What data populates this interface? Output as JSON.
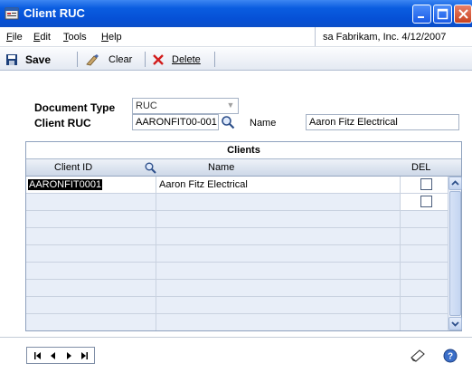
{
  "window": {
    "title": "Client RUC"
  },
  "menu": {
    "items": [
      {
        "label": "File",
        "accel": "F",
        "rest": "ile"
      },
      {
        "label": "Edit",
        "accel": "E",
        "rest": "dit"
      },
      {
        "label": "Tools",
        "accel": "T",
        "rest": "ools"
      },
      {
        "label": "Help",
        "accel": "H",
        "rest": "elp"
      }
    ],
    "user_info": "sa  Fabrikam, Inc.  4/12/2007"
  },
  "toolbar": {
    "save_label": "Save",
    "clear_label": "Clear",
    "delete_label": "Delete"
  },
  "form": {
    "document_type_label": "Document Type",
    "document_type_value": "RUC",
    "client_ruc_label": "Client RUC",
    "client_ruc_value": "AARONFIT00-001",
    "name_label": "Name",
    "name_value": "Aaron Fitz Electrical"
  },
  "grid": {
    "caption": "Clients",
    "columns": {
      "client_id": "Client ID",
      "name": "Name",
      "del": "DEL"
    },
    "rows": [
      {
        "client_id": "AARONFIT0001",
        "name": "Aaron Fitz Electrical",
        "del": false
      },
      {
        "client_id": "",
        "name": "",
        "del": false
      }
    ]
  },
  "icons": [
    "app-icon",
    "minimize-icon",
    "maximize-icon",
    "close-icon",
    "save-icon",
    "clear-icon",
    "delete-icon",
    "lookup-icon",
    "dropdown-arrow-icon",
    "first-record-icon",
    "previous-record-icon",
    "next-record-icon",
    "last-record-icon",
    "note-icon",
    "help-icon"
  ]
}
